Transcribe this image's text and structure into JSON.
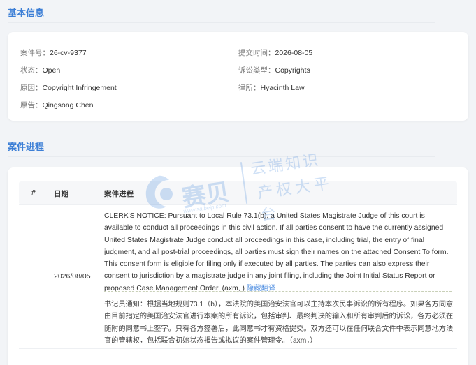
{
  "basic": {
    "title": "基本信息",
    "case_no_label": "案件号：",
    "case_no": "26-cv-9377",
    "submit_label": "提交时间：",
    "submit_time": "2026-08-05",
    "status_label": "状态：",
    "status": "Open",
    "type_label": "诉讼类型：",
    "type": "Copyrights",
    "cause_label": "原因：",
    "cause": "Copyright Infringement",
    "firm_label": "律所：",
    "firm": "Hyacinth Law",
    "plaintiff_label": "原告：",
    "plaintiff": "Qingsong Chen"
  },
  "progress": {
    "title": "案件进程",
    "headers": {
      "num": "#",
      "date": "日期",
      "entry": "案件进程"
    },
    "rows": [
      {
        "date": "2026/08/05",
        "entry_en": "CLERK'S NOTICE: Pursuant to Local Rule 73.1(b), a United States Magistrate Judge of this court is available to conduct all proceedings in this civil action. If all parties consent to have the currently assigned United States Magistrate Judge conduct all proceedings in this case, including trial, the entry of final judgment, and all post-trial proceedings, all parties must sign their names on the attached Consent To form. This consent form is eligible for filing only if executed by all parties. The parties can also express their consent to jurisdiction by a magistrate judge in any joint filing, including the Joint Initial Status Report or proposed Case Management Order. (axm, )",
        "hide_translation": "隐藏翻译",
        "entry_zh": "书记员通知：根据当地规则73.1（b），本法院的美国治安法官可以主持本次民事诉讼的所有程序。如果各方同意由目前指定的美国治安法官进行本案的所有诉讼，包括审判、最终判决的输入和所有审判后的诉讼，各方必须在随附的同意书上签字。只有各方签署后，此同意书才有资格提交。双方还可以在任何联合文件中表示同意地方法官的管辖权，包括联合初始状态报告或拟议的案件管理令。（axm，）"
      }
    ]
  },
  "watermark": {
    "brand": "赛贝",
    "url": "www.saibeip.com",
    "slogan_line1": "云端知识",
    "slogan_line2": "产权大平台"
  },
  "colors": {
    "accent": "#3d7fd6",
    "link": "#4a8be0",
    "background": "#f2f4f7"
  }
}
